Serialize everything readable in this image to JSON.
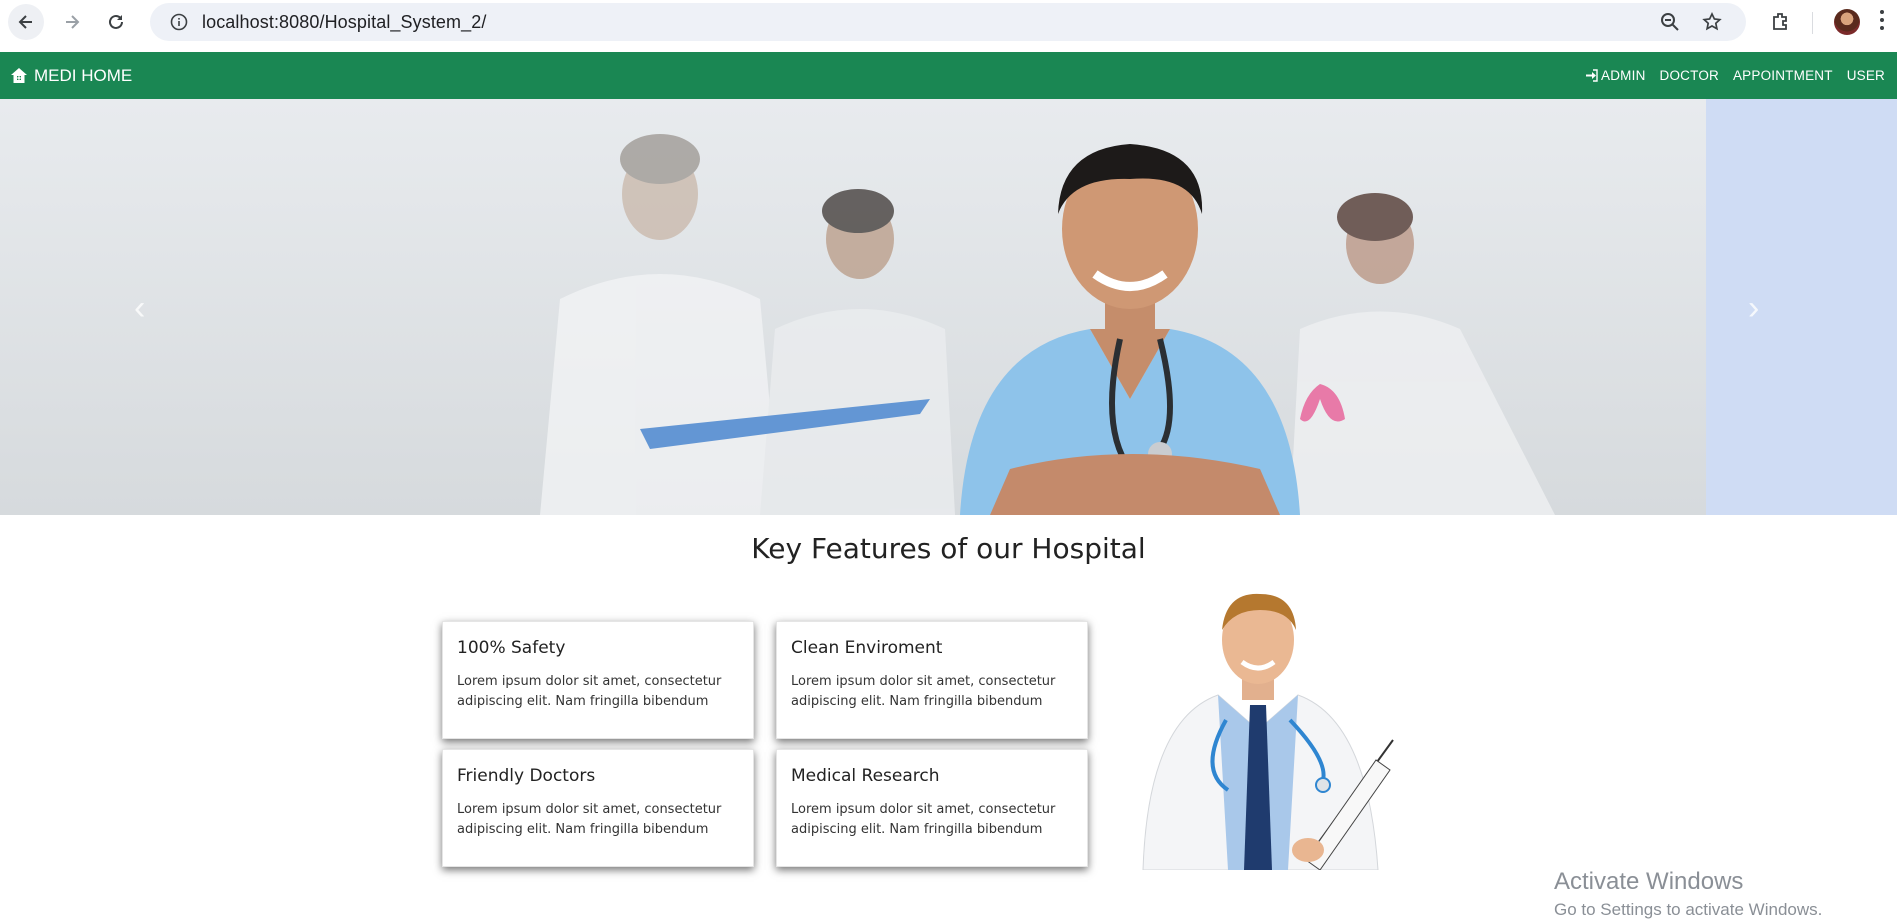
{
  "browser": {
    "url": "localhost:8080/Hospital_System_2/"
  },
  "site": {
    "brand": "MEDI HOME",
    "nav": [
      {
        "label": "ADMIN",
        "icon": "sign-in-icon"
      },
      {
        "label": "DOCTOR"
      },
      {
        "label": "APPOINTMENT"
      },
      {
        "label": "USER"
      }
    ]
  },
  "features": {
    "title": "Key Features of our Hospital",
    "cards": [
      {
        "title": "100% Safety",
        "text": "Lorem ipsum dolor sit amet, consectetur adipiscing elit. Nam fringilla bibendum"
      },
      {
        "title": "Clean Enviroment",
        "text": "Lorem ipsum dolor sit amet, consectetur adipiscing elit. Nam fringilla bibendum"
      },
      {
        "title": "Friendly Doctors",
        "text": "Lorem ipsum dolor sit amet, consectetur adipiscing elit. Nam fringilla bibendum"
      },
      {
        "title": "Medical Research",
        "text": "Lorem ipsum dolor sit amet, consectetur adipiscing elit. Nam fringilla bibendum"
      }
    ]
  },
  "watermark": {
    "line1": "Activate Windows",
    "line2": "Go to Settings to activate Windows."
  },
  "colors": {
    "navbar": "#1a8753",
    "hero_side": "#cfdcf4"
  }
}
